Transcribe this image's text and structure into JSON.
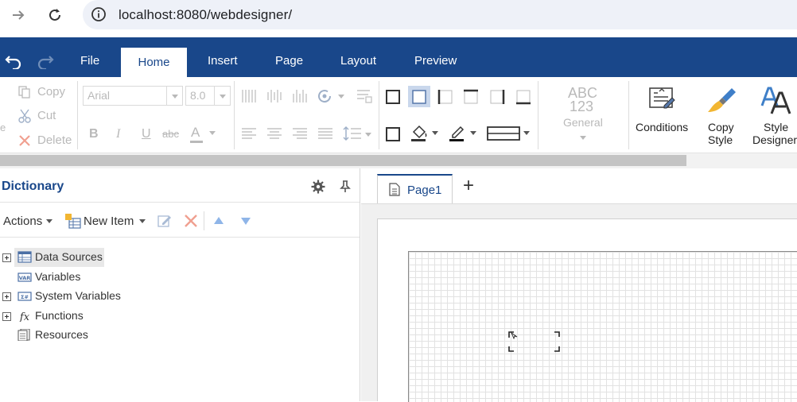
{
  "browser": {
    "url": "localhost:8080/webdesigner/"
  },
  "ribbon_tabs": {
    "file": "File",
    "home": "Home",
    "insert": "Insert",
    "page": "Page",
    "layout": "Layout",
    "preview": "Preview"
  },
  "clipboard": {
    "copy": "Copy",
    "cut": "Cut",
    "delete": "Delete",
    "paste_fragment": "e"
  },
  "font": {
    "family": "Arial",
    "size": "8.0",
    "bold": "B",
    "italic": "I",
    "underline": "U",
    "strike": "abc",
    "color": "A"
  },
  "format": {
    "abc": "ABC",
    "num": "123",
    "general": "General"
  },
  "style_buttons": {
    "conditions": "Conditions",
    "copy_style_1": "Copy",
    "copy_style_2": "Style",
    "style_designer_1": "Style",
    "style_designer_2": "Designer"
  },
  "dictionary": {
    "title": "Dictionary",
    "actions": "Actions",
    "new_item": "New Item",
    "items": [
      {
        "label": "Data Sources"
      },
      {
        "label": "Variables"
      },
      {
        "label": "System Variables"
      },
      {
        "label": "Functions"
      },
      {
        "label": "Resources"
      }
    ]
  },
  "designer": {
    "page_tab": "Page1",
    "add_page": "+"
  },
  "colors": {
    "accent": "#19478a",
    "disabled": "#b9b9b9",
    "tree_highlight": "#e8e8e8"
  }
}
